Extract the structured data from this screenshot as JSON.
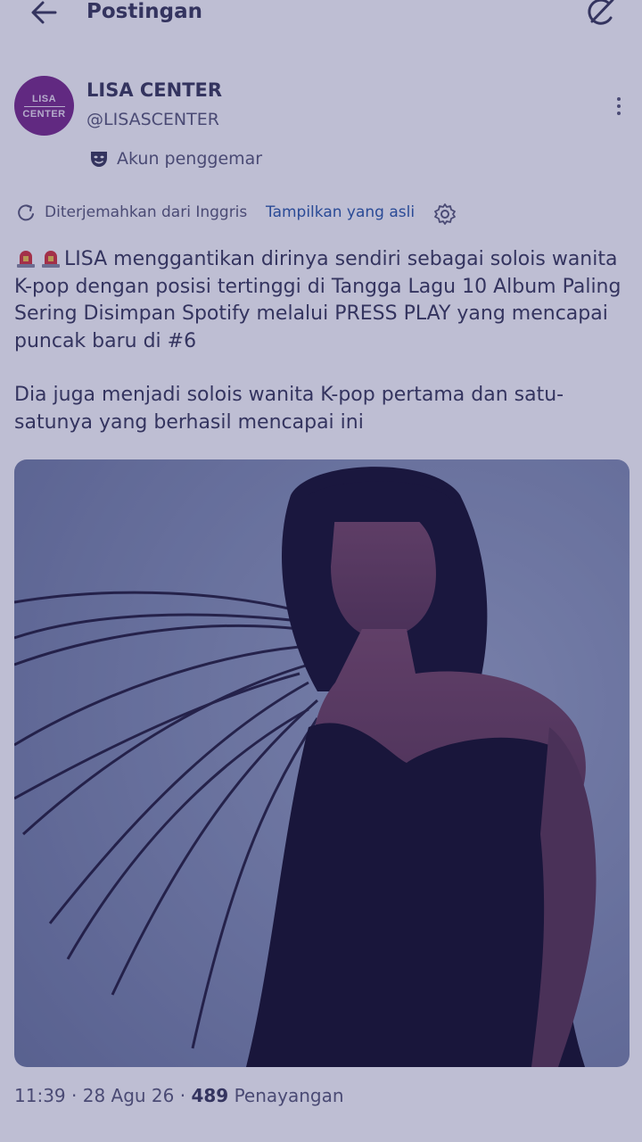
{
  "header": {
    "title": "Postingan",
    "back_icon": "arrow-left-icon",
    "grok_icon": "grok-icon"
  },
  "author": {
    "avatar_text_line1": "LISA",
    "avatar_text_line2": "CENTER",
    "name": "LISA CENTER",
    "handle": "@LISASCENTER",
    "badge_label": "Akun penggemar",
    "badge_icon": "fan-mask-icon",
    "more_icon": "more-vertical-icon"
  },
  "translation": {
    "label": "Diterjemahkan dari Inggris",
    "show_original": "Tampilkan yang asli",
    "settings_icon": "gear-icon"
  },
  "tweet": {
    "emoji": "🚨🚨",
    "paragraph1": "LISA menggantikan dirinya sendiri sebagai solois wanita K-pop dengan posisi tertinggi di Tangga Lagu 10 Album Paling Sering Disimpan Spotify melalui PRESS PLAY yang mencapai puncak baru di #6",
    "paragraph2": "Dia juga menjadi solois wanita K-pop pertama dan satu-satunya yang berhasil mencapai ini"
  },
  "meta": {
    "time": "11:39",
    "separator": "·",
    "date": "28 Agu 26",
    "views_count": "489",
    "views_label": "Penayangan"
  },
  "colors": {
    "text_primary": "#3a3a5a",
    "text_secondary": "#5a5a78",
    "link": "#2c5aa8",
    "avatar_bg": "#7a2a8a",
    "overlay": "#28286e"
  }
}
